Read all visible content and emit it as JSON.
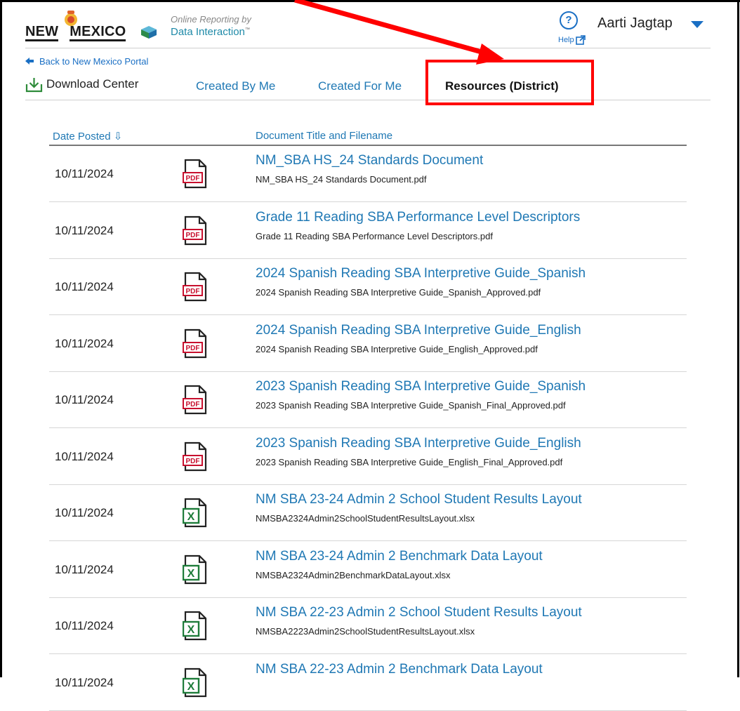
{
  "header": {
    "logo_new": "NEW",
    "logo_mexico": "MEXICO",
    "online_reporting": "Online Reporting by",
    "data_interaction": "Data Interaction",
    "tm": "™",
    "help_label": "Help",
    "help_glyph": "?",
    "user_name": "Aarti Jagtap"
  },
  "nav": {
    "back_label": "Back to New Mexico Portal",
    "download_center": "Download Center",
    "tabs": [
      {
        "label": "Created By Me"
      },
      {
        "label": "Created For Me"
      },
      {
        "label": "Resources (District)"
      }
    ],
    "active_tab": "Resources (District)"
  },
  "table": {
    "col_date": "Date Posted ⇩",
    "col_title": "Document Title and Filename",
    "rows": [
      {
        "date": "10/11/2024",
        "type": "pdf",
        "title": "NM_SBA HS_24 Standards Document",
        "filename": "NM_SBA HS_24 Standards Document.pdf"
      },
      {
        "date": "10/11/2024",
        "type": "pdf",
        "title": "Grade 11 Reading SBA Performance Level Descriptors",
        "filename": "Grade 11 Reading SBA Performance Level Descriptors.pdf"
      },
      {
        "date": "10/11/2024",
        "type": "pdf",
        "title": "2024 Spanish Reading SBA Interpretive Guide_Spanish",
        "filename": "2024 Spanish Reading SBA Interpretive Guide_Spanish_Approved.pdf"
      },
      {
        "date": "10/11/2024",
        "type": "pdf",
        "title": "2024 Spanish Reading SBA Interpretive Guide_English",
        "filename": "2024 Spanish Reading SBA Interpretive Guide_English_Approved.pdf"
      },
      {
        "date": "10/11/2024",
        "type": "pdf",
        "title": "2023 Spanish Reading SBA Interpretive Guide_Spanish",
        "filename": "2023 Spanish Reading SBA Interpretive Guide_Spanish_Final_Approved.pdf"
      },
      {
        "date": "10/11/2024",
        "type": "pdf",
        "title": "2023 Spanish Reading SBA Interpretive Guide_English",
        "filename": "2023 Spanish Reading SBA Interpretive Guide_English_Final_Approved.pdf"
      },
      {
        "date": "10/11/2024",
        "type": "xlsx",
        "title": "NM SBA 23-24 Admin 2 School Student Results Layout",
        "filename": "NMSBA2324Admin2SchoolStudentResultsLayout.xlsx"
      },
      {
        "date": "10/11/2024",
        "type": "xlsx",
        "title": "NM SBA 23-24 Admin 2 Benchmark Data Layout",
        "filename": "NMSBA2324Admin2BenchmarkDataLayout.xlsx"
      },
      {
        "date": "10/11/2024",
        "type": "xlsx",
        "title": "NM SBA 22-23 Admin 2 School Student Results Layout",
        "filename": "NMSBA2223Admin2SchoolStudentResultsLayout.xlsx"
      },
      {
        "date": "10/11/2024",
        "type": "xlsx",
        "title": "NM SBA 22-23 Admin 2 Benchmark Data Layout",
        "filename": ""
      }
    ]
  },
  "icons": {
    "pdf_text": "PDF",
    "xlsx_text": "X",
    "pdf_color": "#c8102e",
    "xlsx_color": "#1e7c3a",
    "link_color": "#1f78b4",
    "annotation_color": "#ff0000"
  }
}
